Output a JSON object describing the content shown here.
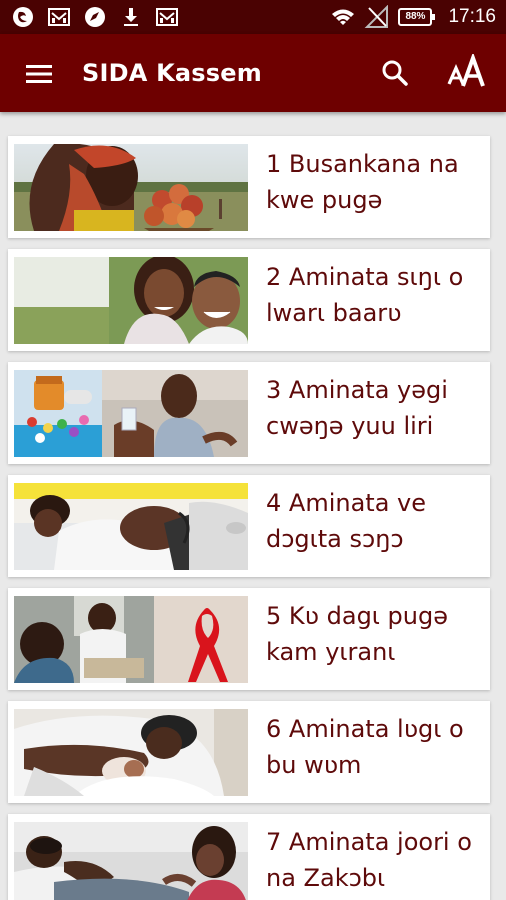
{
  "status_bar": {
    "time": "17:16",
    "battery": "88%",
    "left_icons": [
      "app-logo-icon",
      "mail-icon",
      "compass-icon",
      "download-icon",
      "mail-icon"
    ],
    "right_icons": [
      "wifi-icon",
      "no-signal-icon",
      "battery-icon"
    ]
  },
  "app_bar": {
    "title": "SIDA Kassem",
    "menu_icon": "hamburger-menu-icon",
    "search_icon": "search-icon",
    "font_size_icon": "font-size-icon",
    "background": "#6e0000",
    "status_background": "#4a0202"
  },
  "chapters": [
    {
      "title": "1 Busankana na kwe pugə",
      "image": "woman-carrying-fruit"
    },
    {
      "title": "2 Aminata sɩŋɩ o lwarɩ baarʋ",
      "image": "couple-smiling"
    },
    {
      "title": "3 Aminata yəgi cwəŋə yuu liri",
      "image": "woman-taking-pills"
    },
    {
      "title": "4 Aminata ve dɔgɩta sɔŋɔ",
      "image": "pregnant-woman-checkup"
    },
    {
      "title": "5 Kʋ dagɩ pugə kam yɩranɩ",
      "image": "clinic-red-ribbon"
    },
    {
      "title": "6 Aminata lʋgɩ o bu wʋm",
      "image": "mother-with-baby"
    },
    {
      "title": "7 Aminata joori o na Zakɔbɩ",
      "image": "man-and-woman-sick"
    }
  ],
  "colors": {
    "title_text": "#5e0a0a",
    "list_background": "#e9e9e9",
    "card_background": "#ffffff"
  }
}
